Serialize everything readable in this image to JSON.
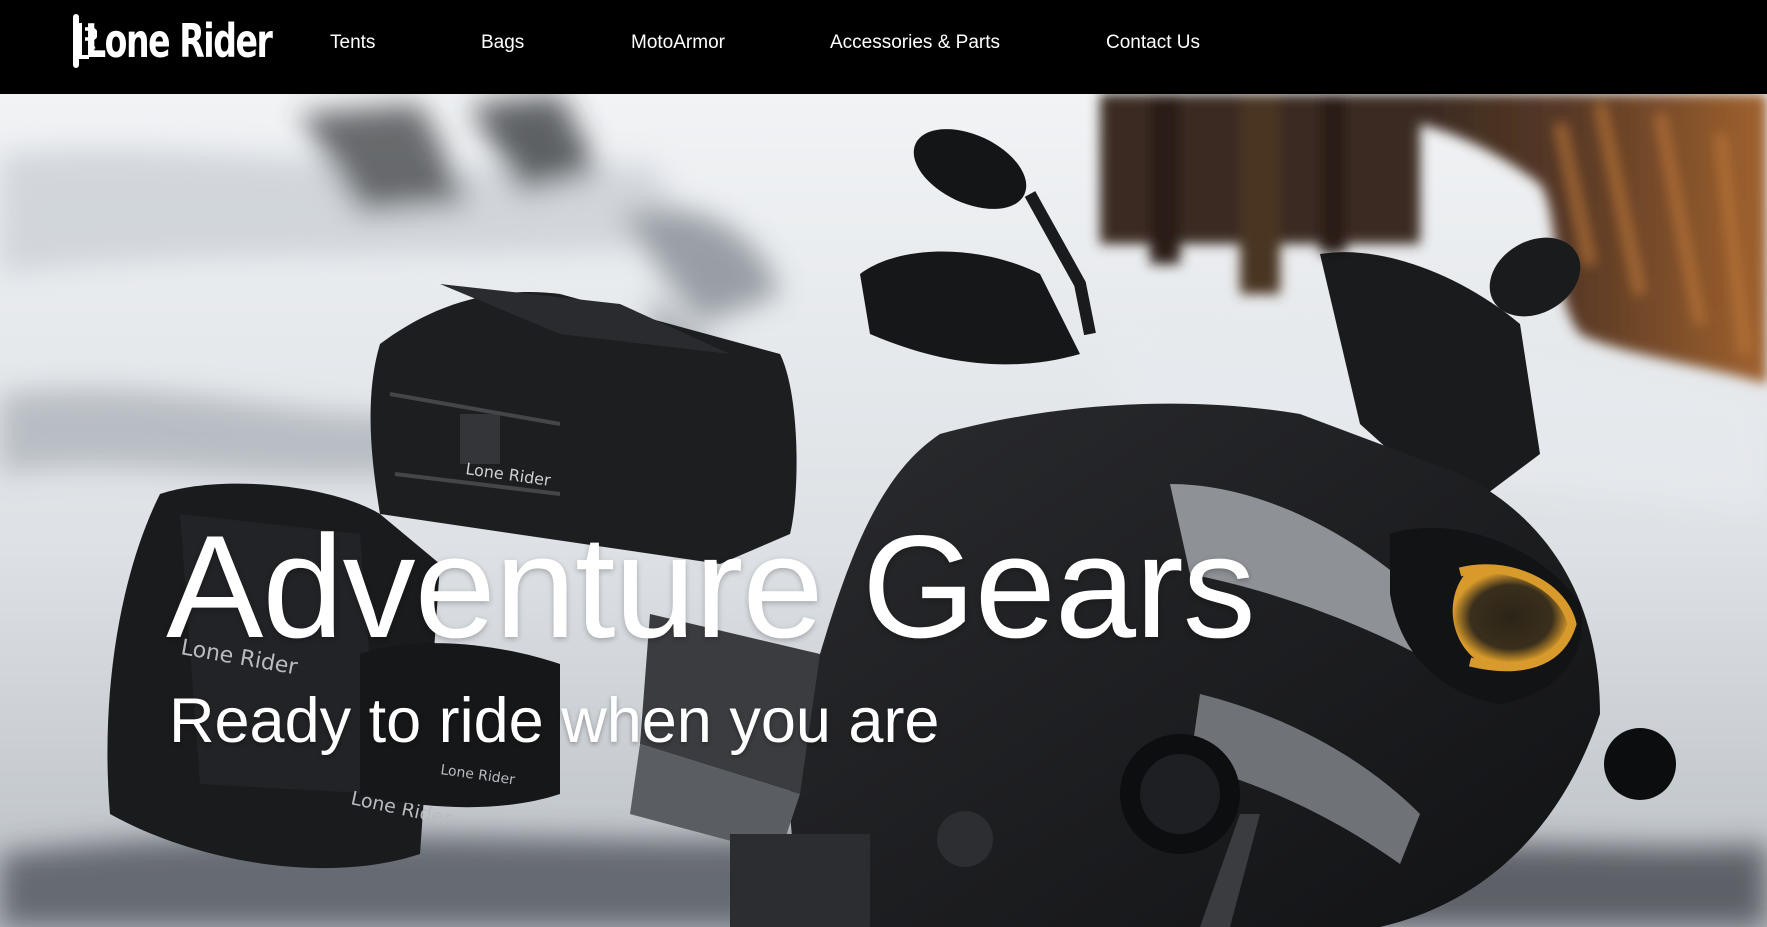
{
  "brand": {
    "name": "Lone Rider",
    "logo_icon": "lr-monogram-icon"
  },
  "nav": {
    "items": [
      {
        "label": "Tents"
      },
      {
        "label": "Bags"
      },
      {
        "label": "MotoArmor"
      },
      {
        "label": "Accessories & Parts"
      },
      {
        "label": "Contact Us"
      }
    ]
  },
  "hero": {
    "title": "Adventure Gears",
    "subtitle": "Ready to ride when you are",
    "background": "photo-motorcycle-with-luggage-in-snow",
    "colors": {
      "snow": "#e8ebee",
      "shadow": "#8a9098",
      "bike": "#1c1d1f",
      "headlight": "#d89a2a",
      "wood": "#8a5228"
    }
  },
  "bag_branding": "Lone Rider"
}
